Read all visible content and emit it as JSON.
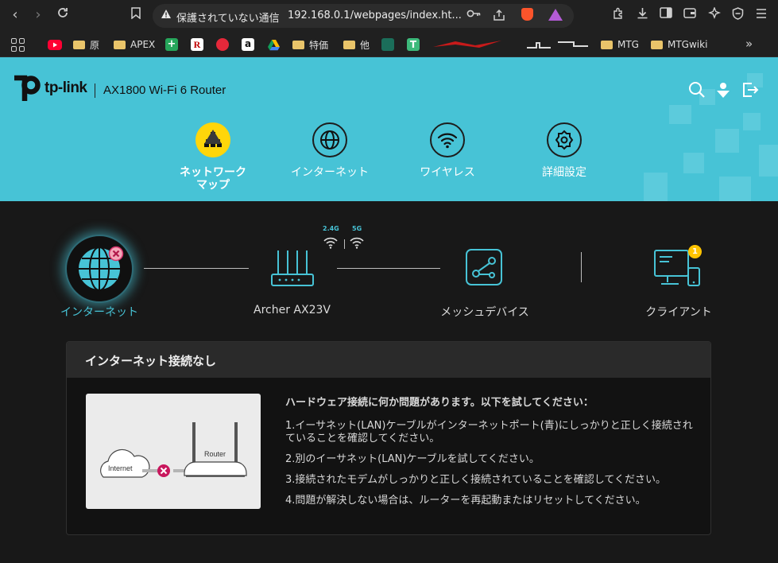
{
  "browser": {
    "insecure_label": "保護されていない通信",
    "url": "192.168.0.1/webpages/index.ht..."
  },
  "bookmarks": [
    {
      "label": "",
      "kind": "youtube"
    },
    {
      "label": "原",
      "kind": "folder"
    },
    {
      "label": "APEX",
      "kind": "folder"
    },
    {
      "label": "",
      "kind": "fav-green-plus"
    },
    {
      "label": "",
      "kind": "fav-R"
    },
    {
      "label": "",
      "kind": "fav-red"
    },
    {
      "label": "",
      "kind": "fav-amazon"
    },
    {
      "label": "",
      "kind": "fav-drive"
    },
    {
      "label": "特価",
      "kind": "folder"
    },
    {
      "label": "他",
      "kind": "folder"
    },
    {
      "label": "",
      "kind": "fav-chart"
    },
    {
      "label": "",
      "kind": "fav-T"
    },
    {
      "label": "MTG",
      "kind": "folder"
    },
    {
      "label": "MTGwiki",
      "kind": "folder"
    }
  ],
  "router": {
    "brand": "tp-link",
    "model": "AX1800 Wi-Fi 6 Router",
    "nav": [
      {
        "label": "ネットワーク\nマップ",
        "icon": "network-map-icon",
        "active": true
      },
      {
        "label": "インターネット",
        "icon": "globe-icon",
        "active": false
      },
      {
        "label": "ワイヤレス",
        "icon": "wifi-icon",
        "active": false
      },
      {
        "label": "詳細設定",
        "icon": "gear-icon",
        "active": false
      }
    ]
  },
  "topology": {
    "internet_label": "インターネット",
    "router_label": "Archer AX23V",
    "band_24": "2.4G",
    "band_5": "5G",
    "mesh_label": "メッシュデバイス",
    "client_label": "クライアント",
    "client_count": "1"
  },
  "status": {
    "title": "インターネット接続なし",
    "illus_internet": "Internet",
    "illus_router": "Router",
    "tips_title": "ハードウェア接続に何か問題があります。以下を試してください：",
    "tips": [
      "1.イーサネット(LAN)ケーブルがインターネットポート(青)にしっかりと正しく接続されていることを確認してください。",
      "2.別のイーサネット(LAN)ケーブルを試してください。",
      "3.接続されたモデムがしっかりと正しく接続されていることを確認してください。",
      "4.問題が解決しない場合は、ルーターを再起動またはリセットしてください。"
    ]
  },
  "colors": {
    "accent": "#47c3d6",
    "active_nav": "#ffd60a",
    "error": "#d6336c",
    "badge": "#ffc300"
  }
}
